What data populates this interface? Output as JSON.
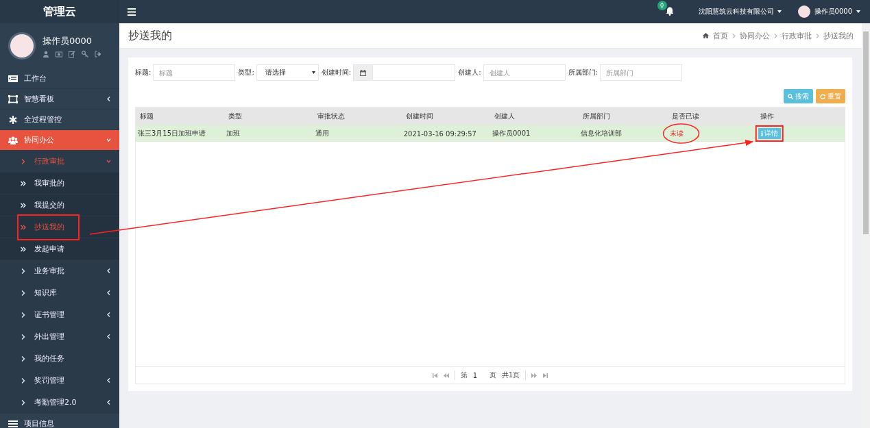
{
  "brand": "管理云",
  "user_panel": {
    "name": "操作员0000"
  },
  "sidebar": {
    "items": [
      {
        "label": "工作台",
        "kind": "link",
        "selected": false
      },
      {
        "label": "智慧看板",
        "kind": "group",
        "expanded": false,
        "selected": false
      },
      {
        "label": "全过程管控",
        "kind": "link",
        "selected": false
      },
      {
        "label": "协同办公",
        "kind": "group",
        "expanded": true,
        "selected": true,
        "children": [
          {
            "label": "行政审批",
            "kind": "group",
            "expanded": true,
            "selected": true,
            "children": [
              {
                "label": "我审批的",
                "kind": "link",
                "selected": false
              },
              {
                "label": "我提交的",
                "kind": "link",
                "selected": false
              },
              {
                "label": "抄送我的",
                "kind": "link",
                "selected": true
              },
              {
                "label": "发起申请",
                "kind": "link",
                "selected": false
              }
            ]
          },
          {
            "label": "业务审批",
            "kind": "group",
            "expanded": false,
            "selected": false
          },
          {
            "label": "知识库",
            "kind": "group",
            "expanded": false,
            "selected": false
          },
          {
            "label": "证书管理",
            "kind": "group",
            "expanded": false,
            "selected": false
          },
          {
            "label": "外出管理",
            "kind": "group",
            "expanded": false,
            "selected": false
          },
          {
            "label": "我的任务",
            "kind": "link",
            "selected": false
          },
          {
            "label": "奖罚管理",
            "kind": "group",
            "expanded": false,
            "selected": false
          },
          {
            "label": "考勤管理2.0",
            "kind": "group",
            "expanded": false,
            "selected": false
          }
        ]
      },
      {
        "label": "项目信息",
        "kind": "link",
        "selected": false
      }
    ]
  },
  "topbar": {
    "notification_count": "0",
    "company": "沈阳慧筑云科技有限公司",
    "user": "操作员0000"
  },
  "page_title": "抄送我的",
  "breadcrumb": [
    "首页",
    "协同办公",
    "行政审批",
    "抄送我的"
  ],
  "filters": [
    {
      "label": "标题:",
      "kind": "text",
      "placeholder": "标题"
    },
    {
      "label": "类型:",
      "kind": "select",
      "value": "请选择"
    },
    {
      "label": "创建时间:",
      "kind": "date"
    },
    {
      "label": "创建人:",
      "kind": "text",
      "placeholder": "创建人"
    },
    {
      "label": "所属部门:",
      "kind": "text",
      "placeholder": "所属部门"
    }
  ],
  "buttons": [
    {
      "label": "搜索",
      "kind": "search"
    },
    {
      "label": "重置",
      "kind": "reset"
    }
  ],
  "table": {
    "columns": [
      "标题",
      "类型",
      "审批状态",
      "创建时间",
      "创建人",
      "所属部门",
      "是否已读",
      "操作"
    ],
    "rows": [
      {
        "selected": true,
        "read": false,
        "cells": [
          "张三3月15日加班申请",
          "加班",
          "通用",
          "2021-03-16 09:29:57",
          "操作员0001",
          "信息化培训部",
          "未读"
        ],
        "action": "详情"
      }
    ]
  },
  "pagination": {
    "prefix": "第",
    "page": "1",
    "suffix": "页",
    "total": "共1页"
  },
  "annotations": [
    {
      "kind": "menu_box"
    },
    {
      "kind": "status_ellipse"
    },
    {
      "kind": "button_box"
    },
    {
      "kind": "arrow"
    }
  ]
}
